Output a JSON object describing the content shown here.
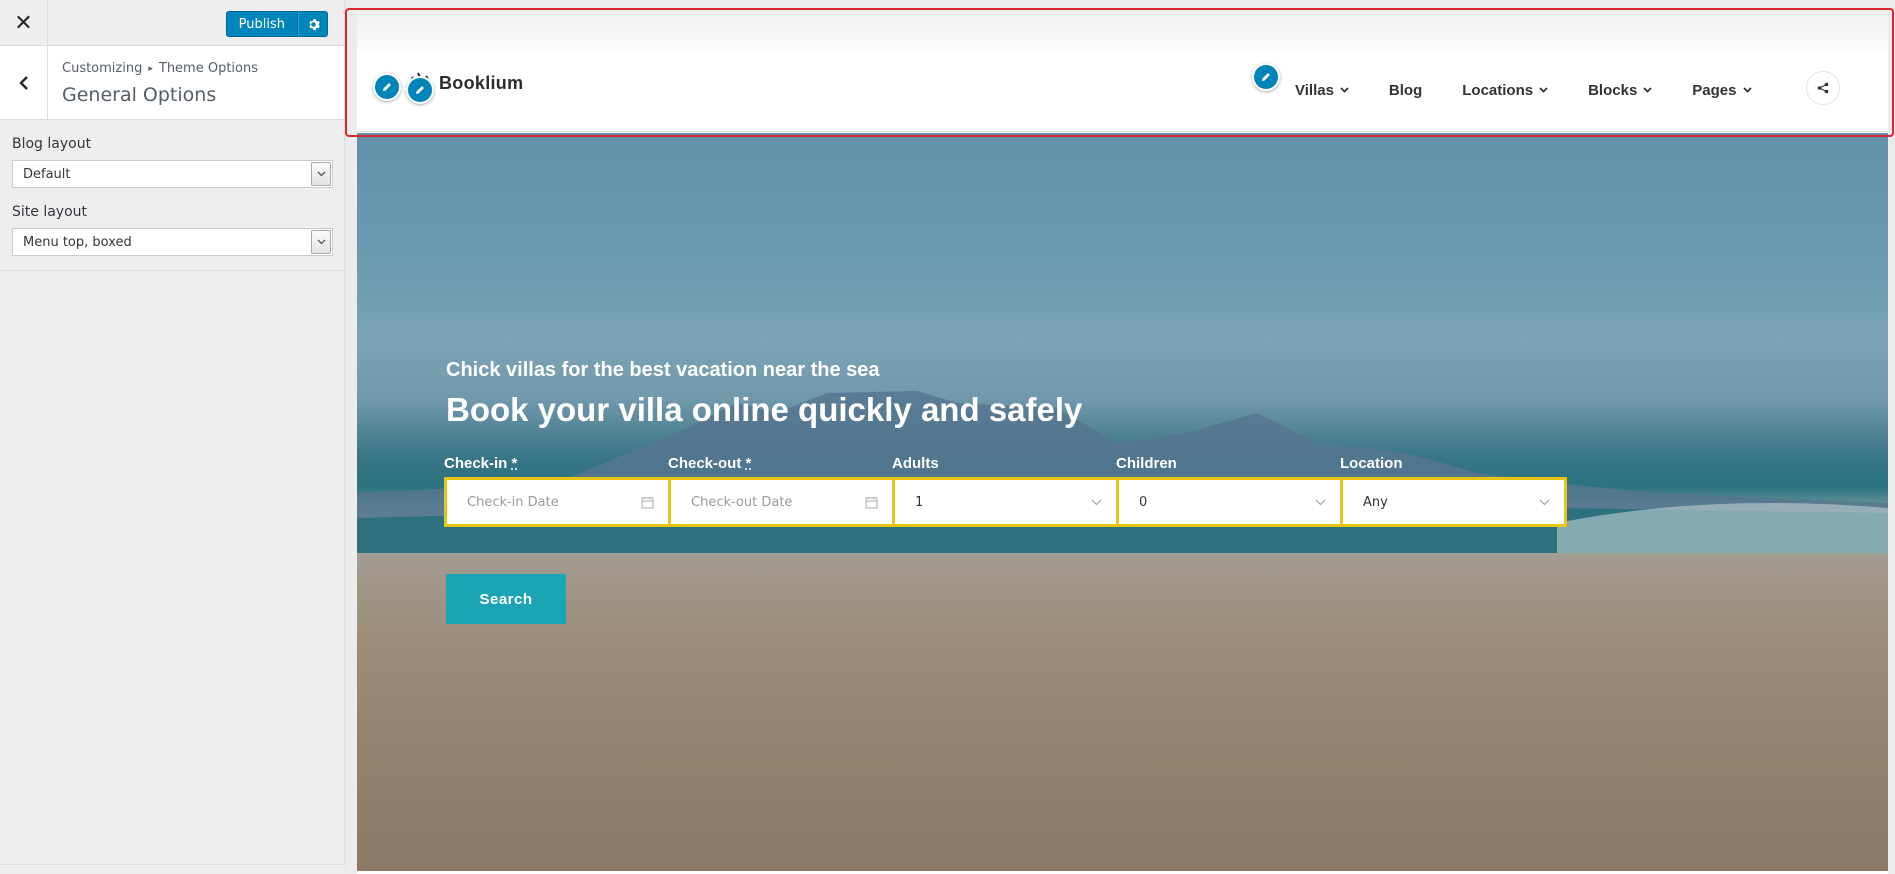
{
  "sidebar": {
    "close_icon": "close-icon",
    "publish_label": "Publish",
    "breadcrumb": {
      "root": "Customizing",
      "separator": "▸",
      "current": "Theme Options"
    },
    "section_title": "General Options",
    "controls": [
      {
        "label": "Blog layout",
        "value": "Default"
      },
      {
        "label": "Site layout",
        "value": "Menu top, boxed"
      }
    ]
  },
  "site": {
    "logo_text": "Booklium",
    "nav": [
      {
        "label": "Villas",
        "has_dropdown": true
      },
      {
        "label": "Blog",
        "has_dropdown": false
      },
      {
        "label": "Locations",
        "has_dropdown": true
      },
      {
        "label": "Blocks",
        "has_dropdown": true
      },
      {
        "label": "Pages",
        "has_dropdown": true
      }
    ],
    "share_icon": "share-icon"
  },
  "hero": {
    "subtitle": "Chick villas for the best vacation near the sea",
    "title": "Book your villa online quickly and safely",
    "fields": [
      {
        "label": "Check-in",
        "required": "*",
        "placeholder": "Check-in Date",
        "icon": "calendar-icon"
      },
      {
        "label": "Check-out",
        "required": "*",
        "placeholder": "Check-out Date",
        "icon": "calendar-icon"
      },
      {
        "label": "Adults",
        "value": "1",
        "icon": "chevron-down-icon"
      },
      {
        "label": "Children",
        "value": "0",
        "icon": "chevron-down-icon"
      },
      {
        "label": "Location",
        "value": "Any",
        "icon": "chevron-down-icon"
      }
    ],
    "search_label": "Search"
  },
  "colors": {
    "accent": "#0085ba",
    "search_button": "#1aa4b4",
    "field_border": "#e9c414",
    "focus_outline": "#d9272e"
  }
}
